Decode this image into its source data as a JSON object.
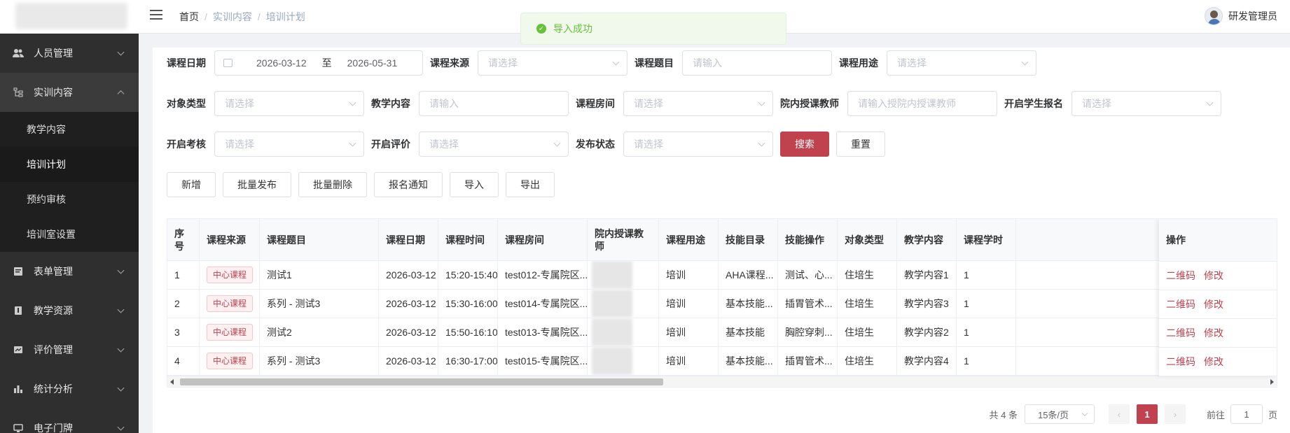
{
  "sidebar": {
    "menus": [
      {
        "label": "人员管理",
        "icon": "users-icon"
      },
      {
        "label": "实训内容",
        "icon": "tree-icon"
      },
      {
        "label": "表单管理",
        "icon": "form-icon"
      },
      {
        "label": "教学资源",
        "icon": "book-icon"
      },
      {
        "label": "评价管理",
        "icon": "rating-icon"
      },
      {
        "label": "统计分析",
        "icon": "bar-chart-icon"
      },
      {
        "label": "电子门牌",
        "icon": "monitor-icon"
      }
    ],
    "submenu": [
      "教学内容",
      "培训计划",
      "预约审核",
      "培训室设置"
    ]
  },
  "header": {
    "breadcrumb": [
      "首页",
      "实训内容",
      "培训计划"
    ],
    "user": "研发管理员"
  },
  "toast": {
    "text": "导入成功"
  },
  "filters": {
    "course_date_label": "课程日期",
    "date_start": "2026-03-12",
    "date_to": "至",
    "date_end": "2026-05-31",
    "course_source_label": "课程来源",
    "course_title_label": "课程题目",
    "course_usage_label": "课程用途",
    "target_type_label": "对象类型",
    "teaching_content_label": "教学内容",
    "course_room_label": "课程房间",
    "teacher_label": "院内授课教师",
    "student_signup_label": "开启学生报名",
    "assessment_label": "开启考核",
    "evaluation_label": "开启评价",
    "publish_status_label": "发布状态",
    "placeholder_select": "请选择",
    "placeholder_input": "请输入",
    "placeholder_teacher": "请输入授院内授课教师",
    "search": "搜索",
    "reset": "重置"
  },
  "actions": {
    "add": "新增",
    "batch_publish": "批量发布",
    "batch_delete": "批量删除",
    "signup_notice": "报名通知",
    "import": "导入",
    "export": "导出"
  },
  "table": {
    "headers": [
      "序号",
      "课程来源",
      "课程题目",
      "课程日期",
      "课程时间",
      "课程房间",
      "院内授课教师",
      "课程用途",
      "技能目录",
      "技能操作",
      "对象类型",
      "教学内容",
      "课程学时"
    ],
    "op_header": "操作",
    "rows": [
      {
        "no": "1",
        "source": "中心课程",
        "title": "测试1",
        "date": "2026-03-12",
        "time": "15:20-15:40",
        "room": "test012-专属院区...",
        "usage": "培训",
        "skill_dir": "AHA课程...",
        "skill_op": "测试、心...",
        "target": "住培生",
        "content": "教学内容1",
        "hours": "1"
      },
      {
        "no": "2",
        "source": "中心课程",
        "title": "系列 - 测试3",
        "date": "2026-03-12",
        "time": "15:30-16:00",
        "room": "test014-专属院区...",
        "usage": "培训",
        "skill_dir": "基本技能...",
        "skill_op": "插胃管术...",
        "target": "住培生",
        "content": "教学内容3",
        "hours": "1"
      },
      {
        "no": "3",
        "source": "中心课程",
        "title": "测试2",
        "date": "2026-03-12",
        "time": "15:50-16:10",
        "room": "test013-专属院区...",
        "usage": "培训",
        "skill_dir": "基本技能",
        "skill_op": "胸腔穿刺...",
        "target": "住培生",
        "content": "教学内容2",
        "hours": "1"
      },
      {
        "no": "4",
        "source": "中心课程",
        "title": "系列 - 测试3",
        "date": "2026-03-12",
        "time": "16:30-17:00",
        "room": "test015-专属院区...",
        "usage": "培训",
        "skill_dir": "基本技能...",
        "skill_op": "插胃管术...",
        "target": "住培生",
        "content": "教学内容4",
        "hours": "1"
      }
    ],
    "op_qrcode": "二维码",
    "op_edit": "修改"
  },
  "pager": {
    "total": "共 4 条",
    "page_size": "15条/页",
    "current": "1",
    "goto": "前往",
    "goto_value": "1",
    "page_unit": "页"
  }
}
